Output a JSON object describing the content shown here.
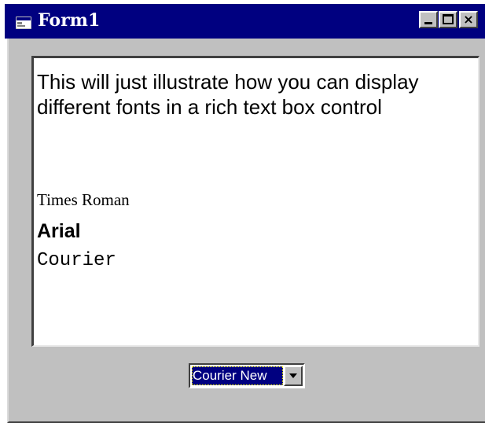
{
  "window": {
    "title": "Form1",
    "title_icon": "form-icon",
    "controls": {
      "minimize_icon": "minimize-icon",
      "maximize_icon": "maximize-icon",
      "close_glyph": "×"
    },
    "colors": {
      "titlebar": "#000080",
      "face": "#c0c0c0"
    }
  },
  "rich_text_box": {
    "intro": "This will just illustrate how you can display different fonts in a rich text box control",
    "lines": [
      {
        "text": "Times Roman",
        "font": "Times Roman"
      },
      {
        "text": "Arial",
        "font": "Arial",
        "bold": true
      },
      {
        "text": "Courier",
        "font": "Courier"
      }
    ]
  },
  "font_combo": {
    "selected": "Courier New",
    "dropdown_icon": "chevron-down-icon"
  }
}
